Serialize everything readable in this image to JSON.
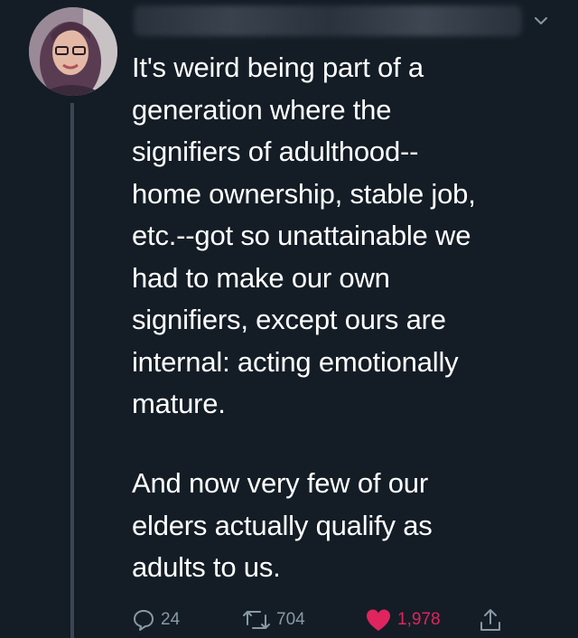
{
  "tweet": {
    "paragraph_one": "It's weird being part of a generation where the signifiers of adulthood--home ownership, stable job, etc.--got so unattainable we had to make our own signifiers, except ours are internal: acting emotionally mature.",
    "paragraph_two": "And now very few of our elders actually qualify as adults to us.",
    "lines_one": [
      "It's weird being part of a",
      "generation where the",
      "signifiers of adulthood--",
      "home ownership, stable job,",
      "etc.--got so unattainable we",
      "had to make our own",
      "signifiers, except ours are",
      "internal: acting emotionally",
      "mature."
    ],
    "lines_two": [
      "And now very few of our",
      "elders actually qualify as",
      "adults to us."
    ]
  },
  "actions": {
    "reply_count": "24",
    "retweet_count": "704",
    "like_count": "1,978"
  },
  "icons": {
    "reply": "reply-icon",
    "retweet": "retweet-icon",
    "like": "heart-icon",
    "share": "share-icon",
    "menu": "chevron-down-icon"
  },
  "colors": {
    "background": "#141d26",
    "text": "#ffffff",
    "muted": "#8899a6",
    "like": "#e0245e"
  }
}
